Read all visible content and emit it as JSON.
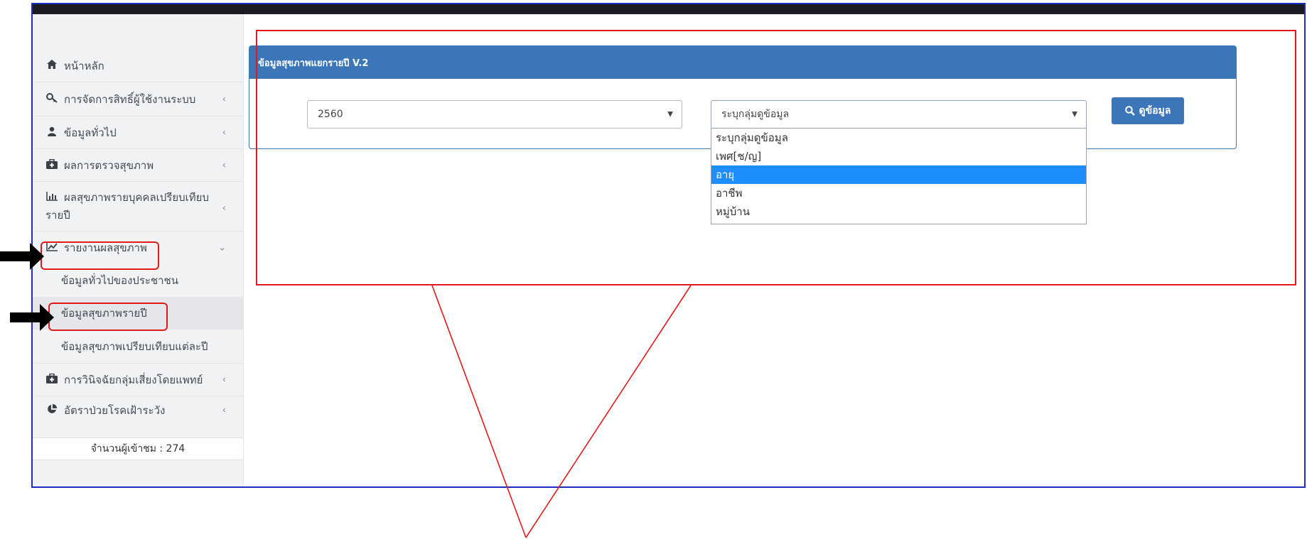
{
  "sidebar": {
    "items": [
      {
        "icon": "home-icon",
        "label": "หน้าหลัก",
        "chevron": ""
      },
      {
        "icon": "key-icon",
        "label": "การจัดการสิทธิ์ผู้ใช้งานระบบ",
        "chevron": "‹"
      },
      {
        "icon": "user-icon",
        "label": "ข้อมูลทั่วไป",
        "chevron": "‹"
      },
      {
        "icon": "medkit-icon",
        "label": "ผลการตรวจสุขภาพ",
        "chevron": "‹"
      },
      {
        "icon": "bar-chart-icon",
        "label": "ผลสุขภาพรายบุคคลเปรียบเทียบรายปี",
        "chevron": "‹"
      },
      {
        "icon": "line-chart-icon",
        "label": "รายงานผลสุขภาพ",
        "chevron": "⌄"
      }
    ],
    "subitems": [
      {
        "label": "ข้อมูลทั่วไปของประชาชน"
      },
      {
        "label": "ข้อมูลสุขภาพรายปี"
      },
      {
        "label": "ข้อมูลสุขภาพเปรียบเทียบแต่ละปี"
      }
    ],
    "items_after": [
      {
        "icon": "medkit-icon",
        "label": "การวินิจฉัยกลุ่มเสี่ยงโดยแพทย์",
        "chevron": "‹"
      },
      {
        "icon": "pie-chart-icon",
        "label": "อัตราป่วยโรคเฝ้าระวัง",
        "chevron": "‹"
      }
    ],
    "visitor_count": "จำนวนผู้เข้าชม : 274"
  },
  "panel": {
    "title": "ข้อมูลสุขภาพแยกรายปี V.2",
    "year_select": "2560",
    "group_select": "ระบุกลุ่มดูข้อมูล",
    "view_button": "ดูข้อมูล",
    "dropdown_options": [
      "ระบุกลุ่มดูข้อมูล",
      "เพศ[ช/ญ]",
      "อายุ",
      "อาชีพ",
      "หมู่บ้าน"
    ],
    "selected_option": "อายุ"
  },
  "colors": {
    "accent": "#3b77b8",
    "highlight": "#1e8eff",
    "annotation": "#e01a1a"
  }
}
